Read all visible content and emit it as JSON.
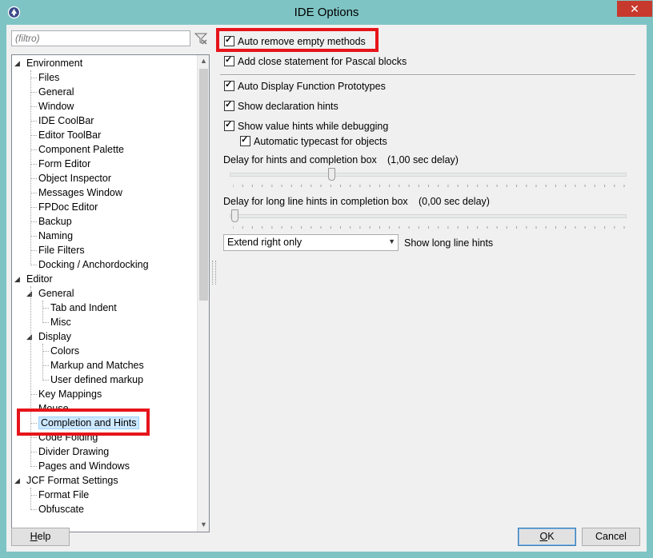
{
  "window": {
    "title": "IDE Options",
    "close_glyph": "✕"
  },
  "filter": {
    "placeholder": "(filtro)",
    "clear_icon": "filter-clear-icon"
  },
  "tree": {
    "items": [
      {
        "label": "Environment",
        "level": 0,
        "expander": "expanded"
      },
      {
        "label": "Files",
        "level": 1
      },
      {
        "label": "General",
        "level": 1
      },
      {
        "label": "Window",
        "level": 1
      },
      {
        "label": "IDE CoolBar",
        "level": 1
      },
      {
        "label": "Editor ToolBar",
        "level": 1
      },
      {
        "label": "Component Palette",
        "level": 1
      },
      {
        "label": "Form Editor",
        "level": 1
      },
      {
        "label": "Object Inspector",
        "level": 1
      },
      {
        "label": "Messages Window",
        "level": 1
      },
      {
        "label": "FPDoc Editor",
        "level": 1
      },
      {
        "label": "Backup",
        "level": 1
      },
      {
        "label": "Naming",
        "level": 1
      },
      {
        "label": "File Filters",
        "level": 1
      },
      {
        "label": "Docking / Anchordocking",
        "level": 1
      },
      {
        "label": "Editor",
        "level": 0,
        "expander": "expanded"
      },
      {
        "label": "General",
        "level": 1,
        "expander": "expanded"
      },
      {
        "label": "Tab and Indent",
        "level": 2
      },
      {
        "label": "Misc",
        "level": 2
      },
      {
        "label": "Display",
        "level": 1,
        "expander": "expanded"
      },
      {
        "label": "Colors",
        "level": 2
      },
      {
        "label": "Markup and Matches",
        "level": 2
      },
      {
        "label": "User defined markup",
        "level": 2
      },
      {
        "label": "Key Mappings",
        "level": 1
      },
      {
        "label": "Mouse",
        "level": 1
      },
      {
        "label": "Completion and Hints",
        "level": 1,
        "selected": true
      },
      {
        "label": "Code Folding",
        "level": 1
      },
      {
        "label": "Divider Drawing",
        "level": 1
      },
      {
        "label": "Pages and Windows",
        "level": 1
      },
      {
        "label": "JCF Format Settings",
        "level": 0,
        "expander": "expanded"
      },
      {
        "label": "Format File",
        "level": 1
      },
      {
        "label": "Obfuscate",
        "level": 1
      }
    ]
  },
  "options": {
    "auto_remove": {
      "label": "Auto remove empty methods",
      "checked": true
    },
    "add_close": {
      "label": "Add close statement for Pascal blocks",
      "checked": true
    },
    "auto_display": {
      "label": "Auto Display Function Prototypes",
      "checked": true
    },
    "show_decl": {
      "label": "Show declaration hints",
      "checked": true
    },
    "show_value": {
      "label": "Show value hints while debugging",
      "checked": true
    },
    "auto_typecast": {
      "label": "Automatic typecast for objects",
      "checked": true
    }
  },
  "delay_hints": {
    "label": "Delay for hints and completion box",
    "value_text": "(1,00 sec delay)",
    "position_fraction": 0.25
  },
  "delay_long": {
    "label": "Delay for long line hints in completion box",
    "value_text": "(0,00 sec delay)",
    "position_fraction": 0.0
  },
  "long_line": {
    "selected": "Extend right only",
    "label": "Show long line hints"
  },
  "buttons": {
    "help_prefix": "",
    "help_hot": "H",
    "help_rest": "elp",
    "ok_hot": "O",
    "ok_rest": "K",
    "cancel": "Cancel"
  },
  "colors": {
    "titlebar": "#7fc4c4",
    "close": "#c7392d",
    "highlight_red": "#e6141b",
    "selection": "#cce8ff"
  }
}
